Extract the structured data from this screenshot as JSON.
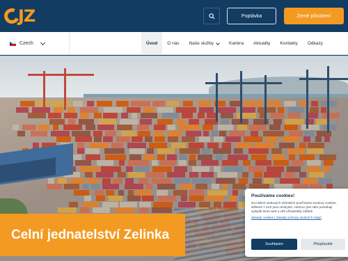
{
  "header": {
    "logo_text": "JZ",
    "search_icon": "search-icon",
    "inquiry_label": "Poptávka",
    "employment_label": "Zemé působení",
    "accent_color": "#f39a22",
    "bar_color": "#123c62"
  },
  "nav": {
    "language": "Czech",
    "items": [
      {
        "label": "Úvod",
        "active": true
      },
      {
        "label": "O nás"
      },
      {
        "label": "Naše služby",
        "has_dropdown": true
      },
      {
        "label": "Kariéra"
      },
      {
        "label": "Aktuality"
      },
      {
        "label": "Kontakty"
      },
      {
        "label": "Odkazy"
      }
    ]
  },
  "hero": {
    "title": "Celní jednatelství Zelinka"
  },
  "cookie": {
    "title": "Používáme cookies!",
    "text": "Na našich webových stránkách používáme soubory cookies. Některé z nich jsou nezbytné, zatímco jiné nám pomáhají vylepšit tento web a váš uživatelský zážitek.",
    "links": "Zásady cookies | Zásady ochrany osobních údajů",
    "accept_label": "Souhlasím",
    "settings_label": "Přizpůsobit"
  }
}
